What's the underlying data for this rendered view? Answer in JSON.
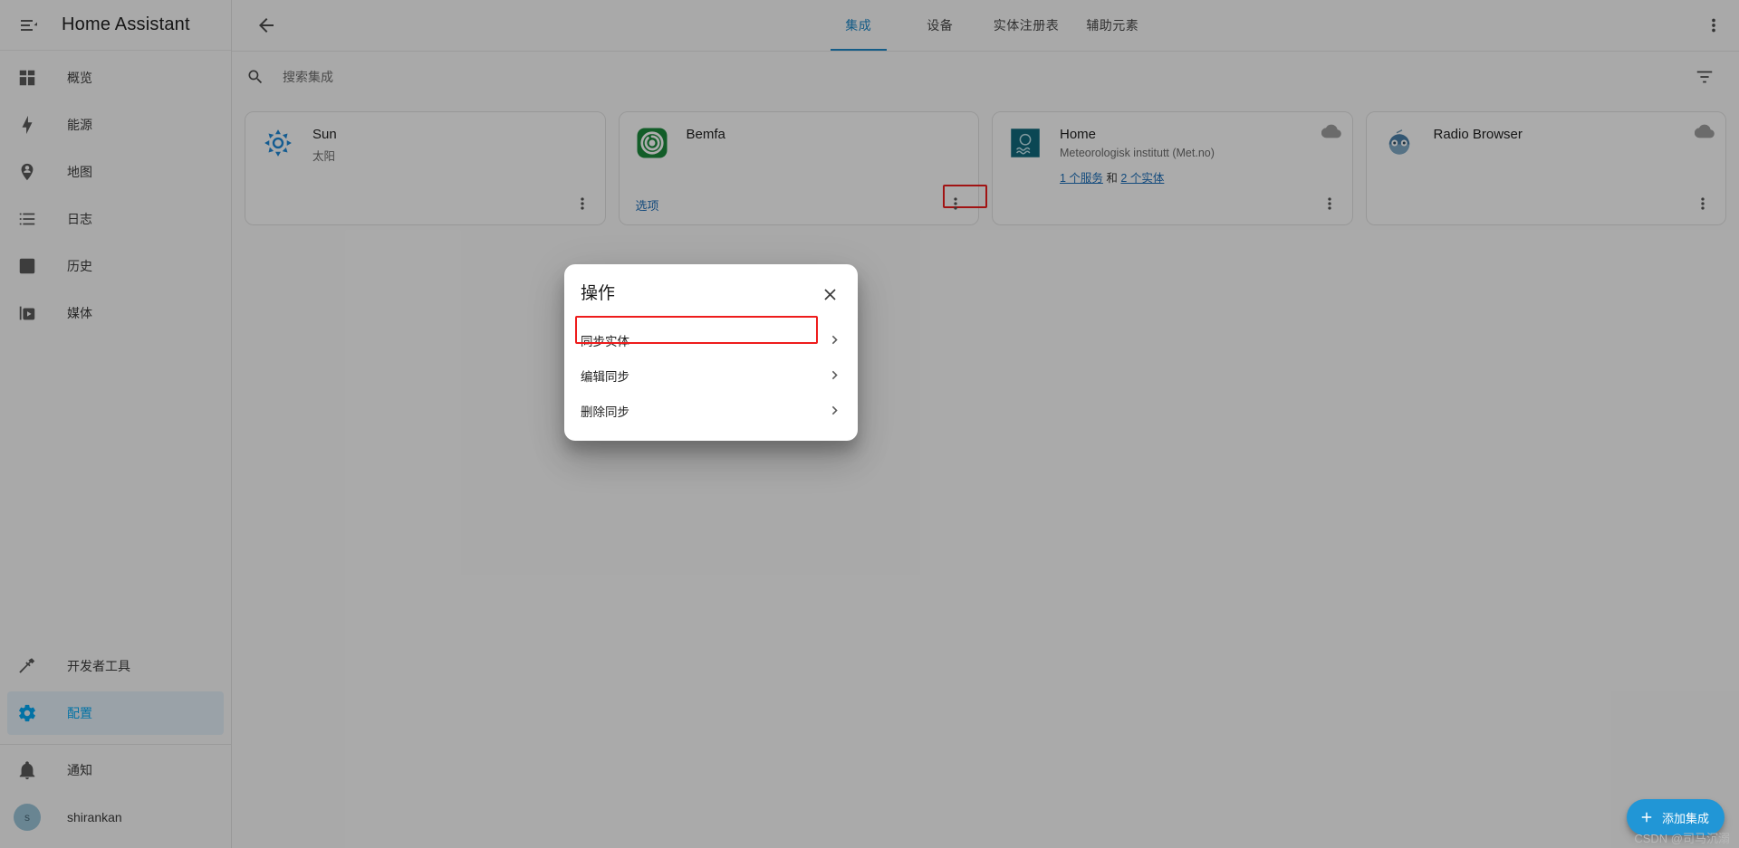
{
  "app": {
    "title": "Home Assistant",
    "accent_color": "#03a9f4",
    "link_color": "#1e6fb8",
    "annotation_color": "#ee1c1c"
  },
  "sidebar": {
    "menu_icon": "menu-open-icon",
    "items": [
      {
        "label": "概览",
        "icon": "view-dashboard-icon"
      },
      {
        "label": "能源",
        "icon": "lightning-bolt-icon"
      },
      {
        "label": "地图",
        "icon": "map-marker-account-icon"
      },
      {
        "label": "日志",
        "icon": "format-list-bulleted-icon"
      },
      {
        "label": "历史",
        "icon": "chart-box-icon"
      },
      {
        "label": "媒体",
        "icon": "play-box-multiple-icon"
      }
    ],
    "tools": [
      {
        "label": "开发者工具",
        "icon": "hammer-icon",
        "active": false
      },
      {
        "label": "配置",
        "icon": "cog-icon",
        "active": true
      }
    ],
    "footer": [
      {
        "label": "通知",
        "icon": "bell-icon"
      },
      {
        "label": "shirankan",
        "icon": "avatar",
        "avatar_initial": "s"
      }
    ]
  },
  "topbar": {
    "back_icon": "arrow-left-icon",
    "overflow_icon": "dots-vertical-icon",
    "tabs": [
      {
        "label": "集成",
        "active": true
      },
      {
        "label": "设备",
        "active": false
      },
      {
        "label": "实体注册表",
        "active": false
      },
      {
        "label": "辅助元素",
        "active": false
      }
    ]
  },
  "search": {
    "icon": "magnify-icon",
    "placeholder": "搜索集成",
    "value": "",
    "filter_icon": "filter-variant-icon"
  },
  "integrations": [
    {
      "name": "Sun",
      "subtitle": "太阳",
      "logo": "sun-icon",
      "logo_color": "#1e88d6",
      "cloud": false,
      "options_label": null,
      "links": null,
      "menu_icon": "dots-vertical-icon"
    },
    {
      "name": "Bemfa",
      "subtitle": "",
      "logo": "bemfa-icon",
      "logo_color": "#1b8a3c",
      "cloud": false,
      "options_label": "选项",
      "links": null,
      "menu_icon": "dots-vertical-icon"
    },
    {
      "name": "Home",
      "subtitle": "Meteorologisk institutt (Met.no)",
      "logo": "metno-icon",
      "logo_color": "#11697d",
      "cloud": true,
      "options_label": null,
      "links": {
        "services": "1 个服务",
        "conjunction": "和",
        "entities": "2 个实体"
      },
      "menu_icon": "dots-vertical-icon"
    },
    {
      "name": "Radio Browser",
      "subtitle": "",
      "logo": "radio-browser-icon",
      "logo_color": "#4b7fa8",
      "cloud": true,
      "options_label": null,
      "links": null,
      "menu_icon": "dots-vertical-icon"
    }
  ],
  "dialog": {
    "title": "操作",
    "close_icon": "close-icon",
    "rows": [
      {
        "label": "同步实体",
        "chevron": "chevron-right-icon",
        "highlighted": true
      },
      {
        "label": "编辑同步",
        "chevron": "chevron-right-icon",
        "highlighted": false
      },
      {
        "label": "删除同步",
        "chevron": "chevron-right-icon",
        "highlighted": false
      }
    ]
  },
  "fab": {
    "icon": "plus-icon",
    "label": "添加集成"
  },
  "watermark": "CSDN @司马沉溺"
}
